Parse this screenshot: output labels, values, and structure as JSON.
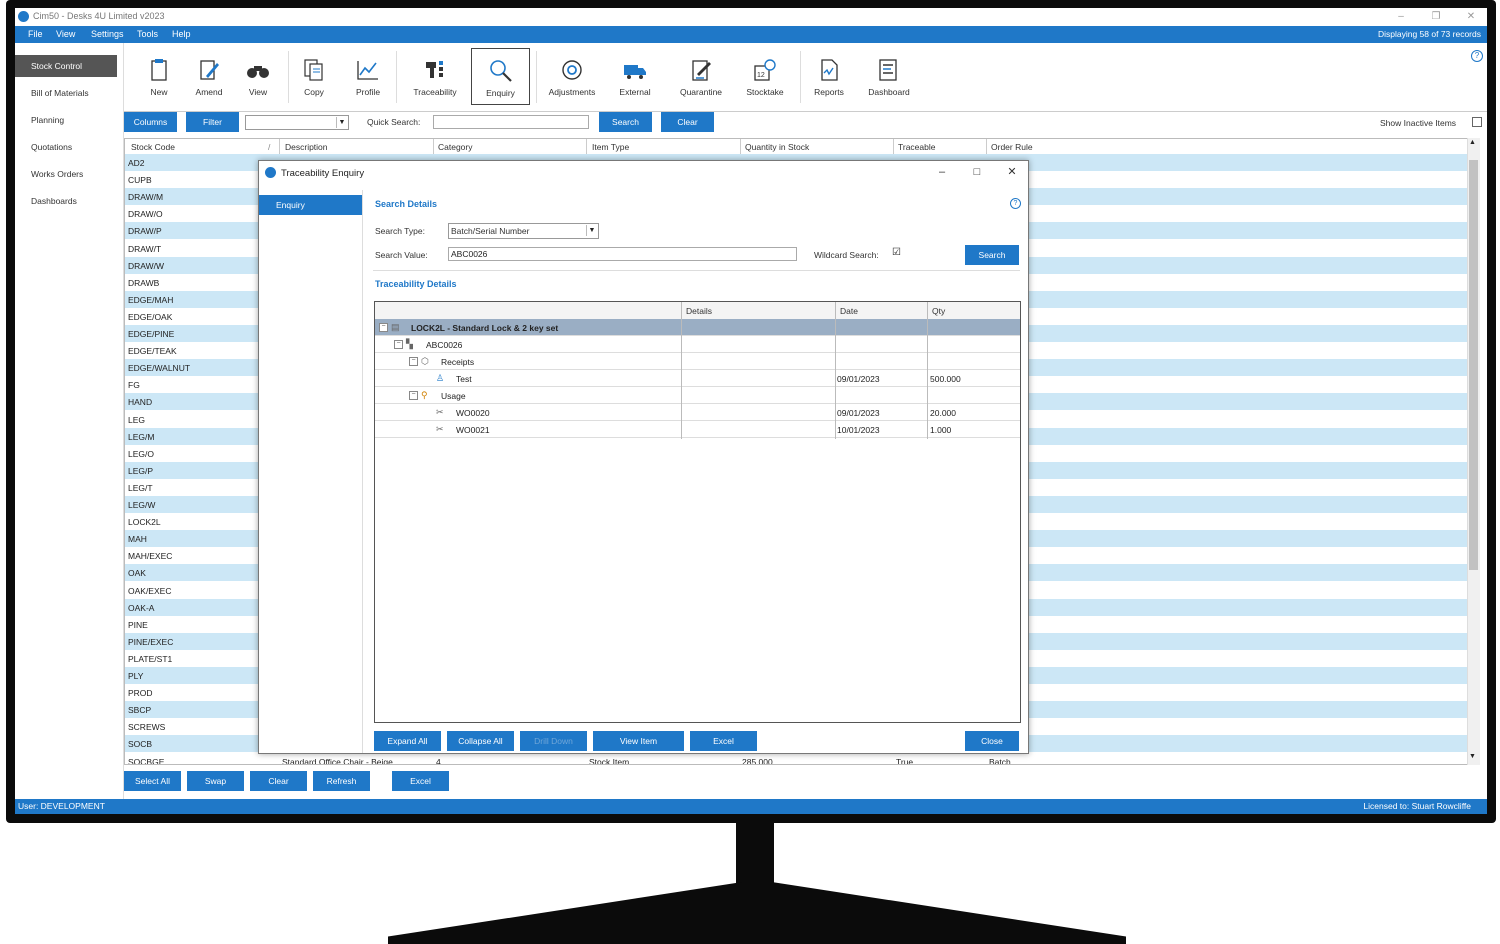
{
  "window": {
    "title": "Cim50 - Desks 4U Limited v2023",
    "controls": [
      "–",
      "❐",
      "✕"
    ]
  },
  "menu": [
    "File",
    "View",
    "Settings",
    "Tools",
    "Help"
  ],
  "record_count": "Displaying 58 of 73 records",
  "nav": [
    "Stock Control",
    "Bill of Materials",
    "Planning",
    "Quotations",
    "Works Orders",
    "Dashboards"
  ],
  "ribbon": [
    {
      "label": "New",
      "icon": "clipboard-icon"
    },
    {
      "label": "Amend",
      "icon": "edit-icon"
    },
    {
      "label": "View",
      "icon": "binoculars-icon"
    },
    {
      "label": "Copy",
      "icon": "copy-icon"
    },
    {
      "label": "Profile",
      "icon": "chart-icon"
    },
    {
      "label": "Traceability",
      "icon": "traceability-icon"
    },
    {
      "label": "Enquiry",
      "icon": "magnifier-icon"
    },
    {
      "label": "Adjustments",
      "icon": "adjust-icon"
    },
    {
      "label": "External",
      "icon": "truck-icon"
    },
    {
      "label": "Quarantine",
      "icon": "quarantine-icon"
    },
    {
      "label": "Stocktake",
      "icon": "stocktake-icon"
    },
    {
      "label": "Reports",
      "icon": "report-icon"
    },
    {
      "label": "Dashboard",
      "icon": "dashboard-icon"
    }
  ],
  "toolbar": {
    "columns": "Columns",
    "filter": "Filter",
    "quick_search_label": "Quick Search:",
    "search": "Search",
    "clear": "Clear",
    "show_inactive": "Show Inactive Items"
  },
  "grid": {
    "headers": [
      "Stock Code",
      "Description",
      "Category",
      "Item Type",
      "Quantity in Stock",
      "Traceable",
      "Order Rule"
    ],
    "codes": [
      "AD2",
      "CUPB",
      "DRAW/M",
      "DRAW/O",
      "DRAW/P",
      "DRAW/T",
      "DRAW/W",
      "DRAWB",
      "EDGE/MAH",
      "EDGE/OAK",
      "EDGE/PINE",
      "EDGE/TEAK",
      "EDGE/WALNUT",
      "FG",
      "HAND",
      "LEG",
      "LEG/M",
      "LEG/O",
      "LEG/P",
      "LEG/T",
      "LEG/W",
      "LOCK2L",
      "MAH",
      "MAH/EXEC",
      "OAK",
      "OAK/EXEC",
      "OAK-A",
      "PINE",
      "PINE/EXEC",
      "PLATE/ST1",
      "PLY",
      "PROD",
      "SBCP",
      "SCREWS",
      "SOCB"
    ],
    "last_row": [
      "SOCBGE",
      "Standard Office Chair - Beige",
      "4",
      "Stock Item",
      "285.000",
      "True",
      "Batch"
    ]
  },
  "bottom_buttons": [
    "Select All",
    "Swap",
    "Clear",
    "Refresh",
    "Excel"
  ],
  "status": {
    "user": "User:  DEVELOPMENT",
    "license": "Licensed to: Stuart Rowcliffe"
  },
  "dialog": {
    "title": "Traceability Enquiry",
    "nav": "Enquiry",
    "search_details": "Search Details",
    "search_type_label": "Search Type:",
    "search_type_value": "Batch/Serial Number",
    "search_value_label": "Search Value:",
    "search_value": "ABC0026",
    "wildcard_label": "Wildcard Search:",
    "wildcard_checked": "☑",
    "search_button": "Search",
    "traceability_details": "Traceability Details",
    "tree_headers": [
      "Details",
      "Date",
      "Qty"
    ],
    "tree": [
      {
        "label": "LOCK2L - Standard Lock & 2 key set",
        "date": "",
        "qty": "",
        "icon": "stock-item-icon"
      },
      {
        "label": "ABC0026",
        "date": "",
        "qty": "",
        "icon": "batch-icon"
      },
      {
        "label": "Receipts",
        "date": "",
        "qty": "",
        "icon": "receipt-icon"
      },
      {
        "label": "Test",
        "date": "09/01/2023",
        "qty": "500.000",
        "icon": "receipt-line-icon"
      },
      {
        "label": "Usage",
        "date": "",
        "qty": "",
        "icon": "usage-icon"
      },
      {
        "label": "WO0020",
        "date": "09/01/2023",
        "qty": "20.000",
        "icon": "tools-icon"
      },
      {
        "label": "WO0021",
        "date": "10/01/2023",
        "qty": "1.000",
        "icon": "tools-icon"
      }
    ],
    "buttons": [
      "Expand All",
      "Collapse All",
      "Drill Down",
      "View Item",
      "Excel"
    ],
    "close": "Close"
  },
  "colors": {
    "accent": "#1f78c8",
    "row_alt": "#cce7f6",
    "tree_selected": "#9aaec4"
  }
}
